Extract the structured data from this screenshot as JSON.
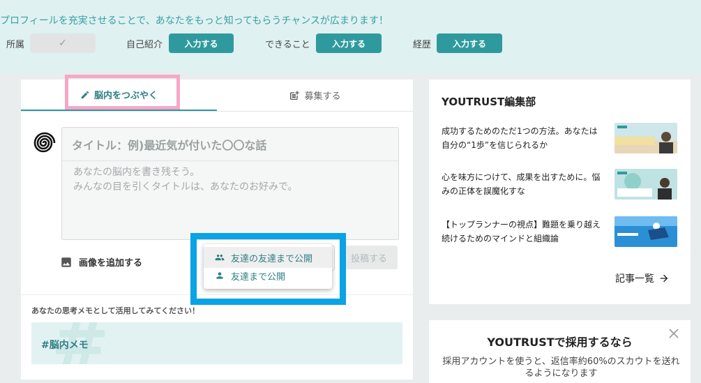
{
  "banner": {
    "message": "プロフィールを充実させることで、あなたをもっと知ってもらうチャンスが広まります！",
    "fields": [
      {
        "label": "所属",
        "status": "done",
        "button": "✓"
      },
      {
        "label": "自己紹介",
        "status": "todo",
        "button": "入力する"
      },
      {
        "label": "できること",
        "status": "todo",
        "button": "入力する"
      },
      {
        "label": "経歴",
        "status": "todo",
        "button": "入力する"
      }
    ]
  },
  "composer": {
    "tabs": [
      {
        "label": "脳内をつぶやく",
        "icon": "pencil-icon",
        "active": true
      },
      {
        "label": "募集する",
        "icon": "post-add-icon",
        "active": false
      }
    ],
    "title_placeholder": "タイトル：例)最近気が付いた〇〇な話",
    "body_placeholder": "あなたの脳内を書き残そう。\nみんなの目を引くタイトルは、あなたのお好みで。",
    "add_image_label": "画像を追加する",
    "submit_label": "投稿する",
    "visibility_options": [
      {
        "label": "友達の友達まで公開",
        "icon": "people-icon",
        "highlighted": true
      },
      {
        "label": "友達まで公開",
        "icon": "person-icon",
        "highlighted": false
      }
    ]
  },
  "memo": {
    "hint": "あなたの思考メモとして活用してみてください！",
    "tag": "#脳内メモ"
  },
  "editorial": {
    "title": "YOUTRUST編集部",
    "articles": [
      {
        "title": "成功するためのただ1つの方法。あなたは自分の“1歩”を信じられるか"
      },
      {
        "title": "心を味方につけて、成果を出すために。悩みの正体を誤魔化すな"
      },
      {
        "title": "【トップランナーの視点】難題を乗り越え続けるためのマインドと組織論"
      }
    ],
    "more_label": "記事一覧"
  },
  "recruit": {
    "title": "YOUTRUSTで採用するなら",
    "description": "採用アカウントを使うと、返信率約60%のスカウトを送れるようになります"
  },
  "colors": {
    "accent": "#2f9a9e",
    "banner_bg": "#dff1f1",
    "highlight_pink": "#f6a7c8",
    "highlight_blue": "#09a3e6"
  }
}
